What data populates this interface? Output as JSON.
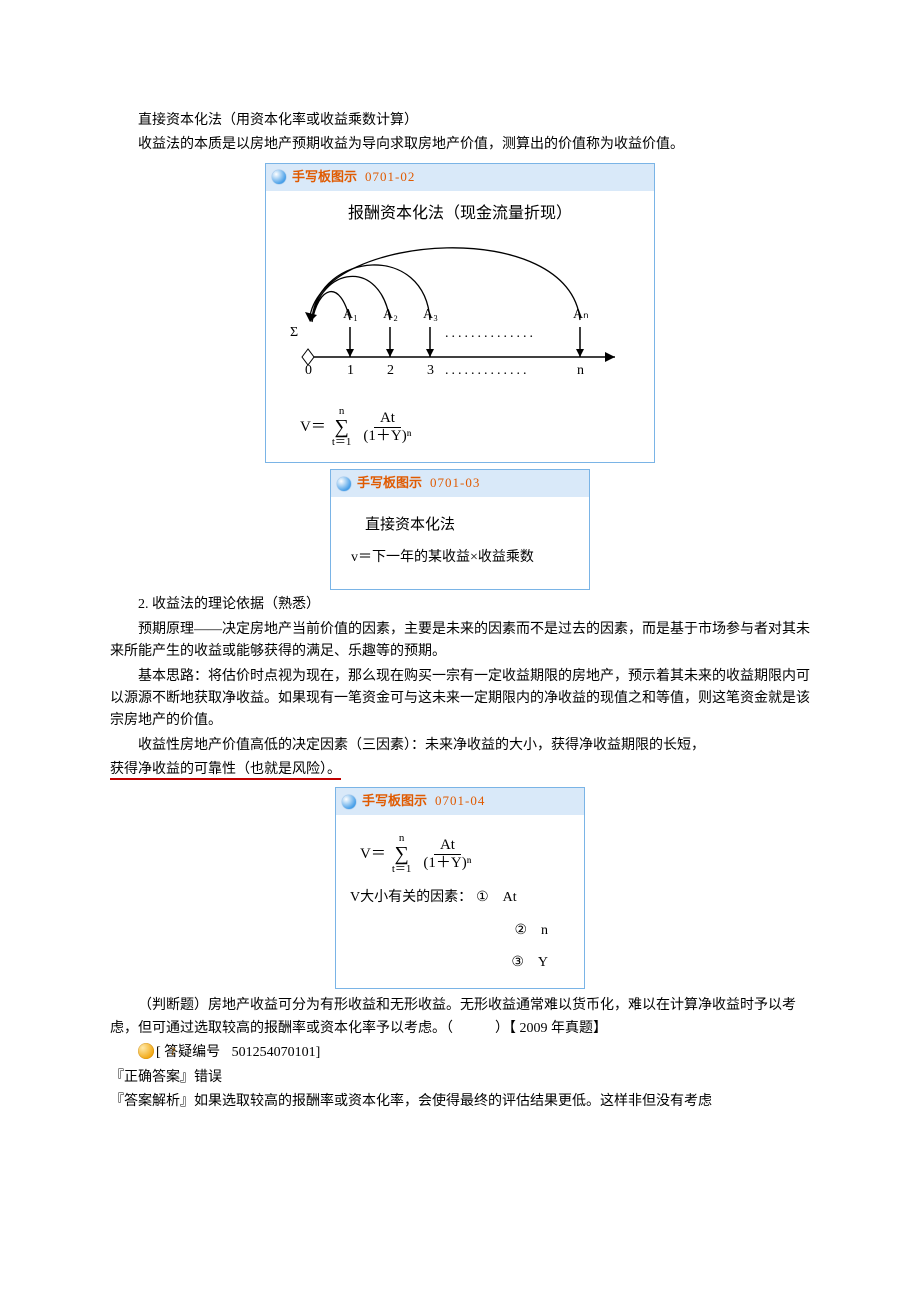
{
  "p1": "直接资本化法（用资本化率或收益乘数计算）",
  "p2": "收益法的本质是以房地产预期收益为导向求取房地产价值，测算出的价值称为收益价值。",
  "ill1": {
    "title": "手写板图示",
    "code": "0701-02",
    "heading": "报酬资本化法（现金流量折现）",
    "labels": {
      "sum": "Σ",
      "a1": "A₁",
      "a2": "A₂",
      "a3": "A₃",
      "an": "Aₙ",
      "n0": "0",
      "n1": "1",
      "n2": "2",
      "n3": "3",
      "nn": "n"
    },
    "formula_left": "V＝",
    "formula_sum_top": "n",
    "formula_sum_sym": "∑",
    "formula_sum_bot": "t＝1",
    "formula_frac_top": "At",
    "formula_frac_bot": "(1＋Y)ⁿ"
  },
  "ill2": {
    "title": "手写板图示",
    "code": "0701-03",
    "line1": "直接资本化法",
    "line2": "v＝下一年的某收益×收益乘数"
  },
  "sec2_title": "2. 收益法的理论依据（熟悉）",
  "p3": "预期原理——决定房地产当前价值的因素，主要是未来的因素而不是过去的因素，而是基于市场参与者对其未来所能产生的收益或能够获得的满足、乐趣等的预期。",
  "p4": "基本思路：将估价时点视为现在，那么现在购买一宗有一定收益期限的房地产，预示着其未来的收益期限内可以源源不断地获取净收益。如果现有一笔资金可与这未来一定期限内的净收益的现值之和等值，则这笔资金就是该宗房地产的价值。",
  "p5a": "收益性房地产价值高低的决定因素（三因素）：未来净收益的大小，获得净收益期限的长短，",
  "p5b": "获得净收益的可靠性（也就是风险）。",
  "ill3": {
    "title": "手写板图示",
    "code": "0701-04",
    "formula_left": "V＝",
    "formula_sum_top": "n",
    "formula_sum_sym": "∑",
    "formula_sum_bot": "t＝1",
    "formula_frac_top": "At",
    "formula_frac_bot": "(1＋Y)ⁿ",
    "line2": "V大小有关的因素：",
    "opt1": "①　At",
    "opt2": "②　n",
    "opt3": "③　Y"
  },
  "q1a": "（判断题）房地产收益可分为有形收益和无形收益。无形收益通常难以货币化，难以在计算净收益时予以考虑，但可通过选取较高的报酬率或资本化率予以考虑。（　　　）【 2009 年真题】",
  "qref_label": "[ 答疑编号",
  "qref_num": "501254070101]",
  "ans_label": "『正确答案』",
  "ans": "错误",
  "explain_label": "『答案解析』",
  "explain": "如果选取较高的报酬率或资本化率，会使得最终的评估结果更低。这样非但没有考虑"
}
